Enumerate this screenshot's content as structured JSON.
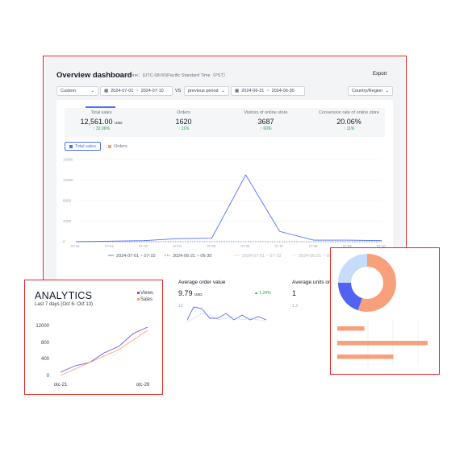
{
  "header": {
    "title": "Overview dashboard",
    "timezone": "Time Zone：(UTC-08:00)Pacific Standard Time（PST）",
    "export_label": "Export"
  },
  "filters": {
    "range_type": "Custom",
    "date_start": "2024-07-01",
    "date_end": "2024-07-10",
    "date_sep": "~",
    "vs_label": "VS",
    "compare_type": "previous period",
    "compare_start": "2024-06-21",
    "compare_end": "2024-06-30",
    "country": "Country/Region"
  },
  "kpis": [
    {
      "label": "Total sales",
      "value": "12,561.00",
      "unit": "USD",
      "change": "↑ 32.06%"
    },
    {
      "label": "Orders",
      "value": "1620",
      "unit": "",
      "change": "↑ 11%"
    },
    {
      "label": "Visitors of online store",
      "value": "3687",
      "unit": "",
      "change": "↑ 60%"
    },
    {
      "label": "Conversion rate of online store",
      "value": "20.06%",
      "unit": "",
      "change": "↑ 11%"
    }
  ],
  "chart_toggles": {
    "total_sales": "Total sales",
    "orders": "Orders"
  },
  "colors": {
    "accent": "#4f6ef7",
    "orange": "#f7a07b",
    "frame": "#e02424",
    "green": "#16a34a",
    "purple": "#8b5cf6"
  },
  "chart_data": [
    {
      "type": "line",
      "x": [
        "07-01",
        "07-02",
        "07-03",
        "07-04",
        "07-05",
        "07-06",
        "07-07",
        "07-08",
        "07-09",
        "07-10"
      ],
      "y_ticks": [
        "16000",
        "12000",
        "8000",
        "4000",
        "0"
      ],
      "ylim": [
        0,
        16000
      ],
      "series": [
        {
          "name": "2024-07-01 ~ 07-10",
          "values": [
            0,
            100,
            200,
            600,
            700,
            13000,
            2000,
            300,
            300,
            200
          ]
        },
        {
          "name": "2024-06-21 ~ 06-30",
          "values": [
            0,
            0,
            0,
            0,
            0,
            0,
            0,
            0,
            0,
            0
          ]
        },
        {
          "name": "2024-07-01 ~ 07-10",
          "values": []
        },
        {
          "name": "2024-06-21 ~ 06-",
          "values": []
        }
      ],
      "legend": "bottom"
    },
    {
      "type": "line",
      "title": "ANALYTICS",
      "subtitle": "Last 7 days (Oct 6- Oct 13)",
      "y_ticks": [
        "12000",
        "800",
        "400",
        "0"
      ],
      "x_ticks": [
        "otc-21",
        "otc-26"
      ],
      "series": [
        {
          "name": "Views",
          "values": [
            1,
            3,
            4,
            7,
            9,
            13,
            15
          ]
        },
        {
          "name": "Sales",
          "values": [
            0,
            2,
            4,
            6,
            8,
            11,
            14
          ]
        }
      ],
      "legend": "top-right"
    },
    {
      "type": "pie",
      "series": [
        {
          "values": [
            55,
            20,
            25
          ]
        }
      ]
    },
    {
      "type": "bar",
      "orientation": "horizontal",
      "values": [
        30,
        100,
        62
      ]
    }
  ],
  "sub_cards": {
    "aov": {
      "title": "Average order value",
      "value": "9.79",
      "unit": "USD",
      "change": "▲ 1.24%",
      "y_top": "12"
    },
    "units": {
      "title": "Average units ord",
      "value": "1",
      "y_top": "1.2"
    }
  }
}
